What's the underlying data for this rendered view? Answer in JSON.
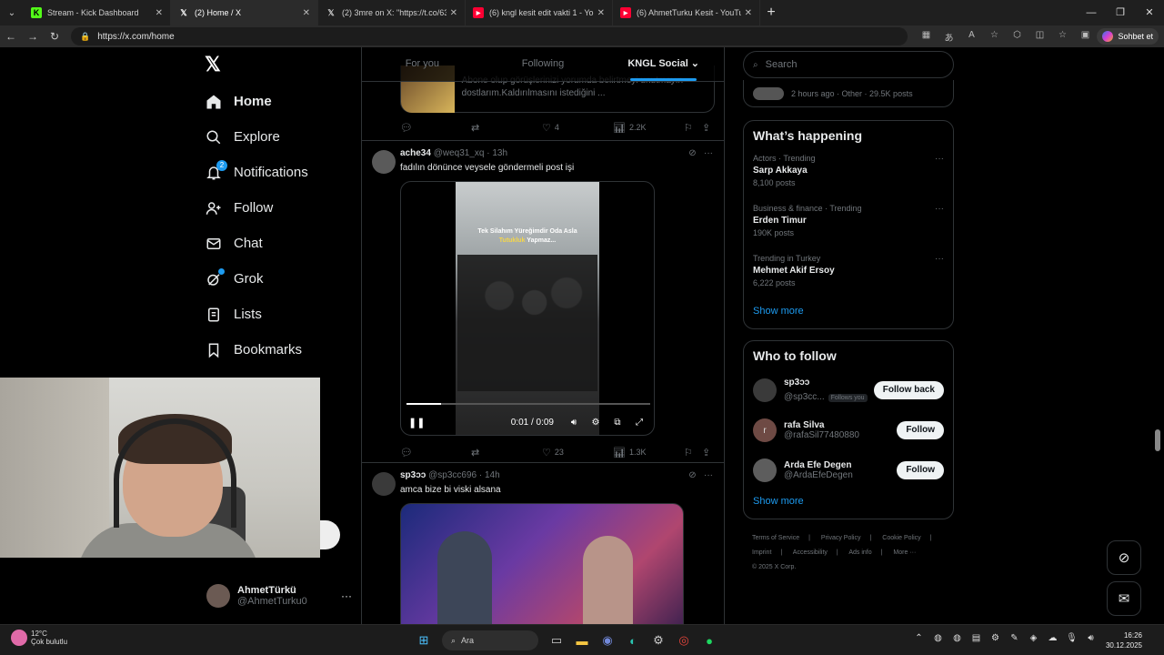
{
  "browser": {
    "tabs": [
      {
        "label": "Stream - Kick Dashboard",
        "favicon": "K",
        "color": "#53fc18"
      },
      {
        "label": "(2) Home / X",
        "favicon": "𝕏",
        "color": "#ffffff"
      },
      {
        "label": "(2) 3mre on X: \"https://t.co/63FSc",
        "favicon": "𝕏",
        "color": "#ffffff"
      },
      {
        "label": "(6) kngl kesit edit vakti 1 - YouTub",
        "favicon": "▶",
        "color": "#ff0033"
      },
      {
        "label": "(6) AhmetTurku Kesit - YouTube",
        "favicon": "▶",
        "color": "#ff0033"
      }
    ],
    "url": "https://x.com/home",
    "copilot_label": "Sohbet et"
  },
  "nav": {
    "logo": "𝕏",
    "items": [
      {
        "label": "Home",
        "icon": "home-icon",
        "glyph": "⌂"
      },
      {
        "label": "Explore",
        "icon": "search-icon",
        "glyph": "⌕"
      },
      {
        "label": "Notifications",
        "icon": "bell-icon",
        "glyph": "♫",
        "badge": "2"
      },
      {
        "label": "Follow",
        "icon": "follow-icon",
        "glyph": "✚"
      },
      {
        "label": "Chat",
        "icon": "mail-icon",
        "glyph": "✉"
      },
      {
        "label": "Grok",
        "icon": "grok-icon",
        "glyph": "⊘"
      },
      {
        "label": "Lists",
        "icon": "list-icon",
        "glyph": "☰"
      },
      {
        "label": "Bookmarks",
        "icon": "bookmark-icon",
        "glyph": "🔖"
      }
    ],
    "profile": {
      "name": "AhmetTürkü",
      "handle": "@AhmetTurku0",
      "more": "···"
    }
  },
  "timeline": {
    "tabs": [
      "For you",
      "Following",
      "KNGL Social ⌄"
    ],
    "prev_card_text": "Abone olup görüşlerinizi yorumda belirtmeyi unutmayın dostlarım.Kaldırılmasını istediğini ...",
    "prev_actions": {
      "reply": "",
      "repost": "",
      "like": "4",
      "views": "2.2K"
    },
    "tweets": [
      {
        "name": "ache34",
        "handle": "@weq31_xq",
        "time": "13h",
        "text": "fadılın dönünce veysele göndermeli post işi",
        "video": {
          "caption_line1": "Tek Silahım Yüreğimdir Oda Asla",
          "caption_line2": "Tutukluk",
          "caption_line3": "Yapmaz...",
          "time": "0:01 / 0:09",
          "progress": 0.14
        },
        "actions": {
          "reply": "",
          "repost": "",
          "like": "23",
          "views": "1.3K"
        }
      },
      {
        "name": "sp3ɔɔ",
        "handle": "@sp3cc696",
        "time": "14h",
        "text": "amca bize bi viski alsana"
      }
    ]
  },
  "sidebar": {
    "search_placeholder": "Search",
    "top_card_text": "2 hours ago · Other · 29.5K posts",
    "whats_happening": {
      "title": "What’s happening",
      "trends": [
        {
          "category": "Actors · Trending",
          "title": "Sarp Akkaya",
          "count": "8,100 posts"
        },
        {
          "category": "Business & finance · Trending",
          "title": "Erden Timur",
          "count": "190K posts"
        },
        {
          "category": "Trending in Turkey",
          "title": "Mehmet Akif Ersoy",
          "count": "6,222 posts"
        }
      ],
      "show_more": "Show more"
    },
    "who_to_follow": {
      "title": "Who to follow",
      "users": [
        {
          "name": "sp3ɔɔ",
          "handle": "@sp3cc...",
          "follows_you": "Follows you",
          "button": "Follow back",
          "initial": ""
        },
        {
          "name": "rafa Silva",
          "handle": "@rafaSil77480880",
          "follows_you": "",
          "button": "Follow",
          "initial": "r"
        },
        {
          "name": "Arda Efe Degen",
          "handle": "@ArdaEfeDegen",
          "follows_you": "",
          "button": "Follow",
          "initial": ""
        }
      ],
      "show_more": "Show more"
    },
    "footer": [
      "Terms of Service",
      "|",
      "Privacy Policy",
      "|",
      "Cookie Policy",
      "|",
      "Imprint",
      "|",
      "Accessibility",
      "|",
      "Ads info",
      "|",
      "More ···",
      "© 2025 X Corp."
    ]
  },
  "taskbar": {
    "temp": "12°C",
    "weather": "Çok bulutlu",
    "search_label": "Ara",
    "time": "16:26",
    "date": "30.12.2025"
  }
}
